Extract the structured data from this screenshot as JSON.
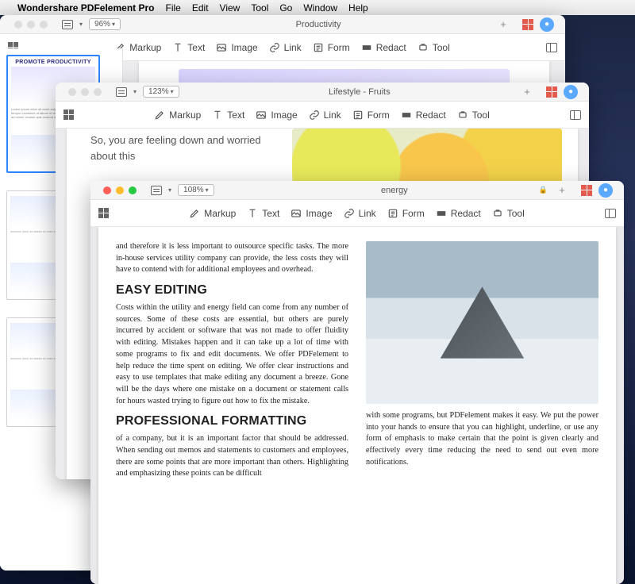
{
  "menubar": {
    "app": "Wondershare PDFelement Pro",
    "items": [
      "File",
      "Edit",
      "View",
      "Tool",
      "Go",
      "Window",
      "Help"
    ]
  },
  "toolbar": {
    "markup": "Markup",
    "text": "Text",
    "image": "Image",
    "link": "Link",
    "form": "Form",
    "redact": "Redact",
    "tool": "Tool"
  },
  "w1": {
    "zoom": "96%",
    "tab": "Productivity",
    "thumb1_title": "PROMOTE PRODUCTIVITY"
  },
  "w2": {
    "zoom": "123%",
    "tab": "Lifestyle - Fruits",
    "copy": "So, you are feeling down and worried about this"
  },
  "w3": {
    "zoom": "108%",
    "tab": "energy",
    "p1": "and therefore it is less important to outsource specific tasks. The more in-house services utility company can provide, the less costs they will have to contend with for additional employees and overhead.",
    "h1": "EASY EDITING",
    "p2": "Costs within the utility and energy field can come from any number of sources. Some of these costs are essential, but others are purely incurred by accident or software that was not made to offer fluidity with editing. Mistakes happen and it can take up a lot of time with some programs to fix and edit documents. We offer PDFelement to help reduce the time spent on editing. We offer clear instructions and easy to use templates that make editing any document a breeze. Gone will be the days where one mistake on a document or statement calls for hours wasted trying to figure out how to fix the mistake.",
    "h2": "PROFESSIONAL FORMATTING",
    "p3": "of a company, but it is an important factor that should be addressed. When sending out memos and statements to customers and employees, there are some points that are more important than others. Highlighting and emphasizing these points can be difficult",
    "p4": "with some programs, but PDFelement makes it easy. We put the power into your hands to ensure that you can highlight, underline, or use any form of emphasis to make certain that the point is given clearly and effectively every time reducing the need to send out even more notifications."
  }
}
